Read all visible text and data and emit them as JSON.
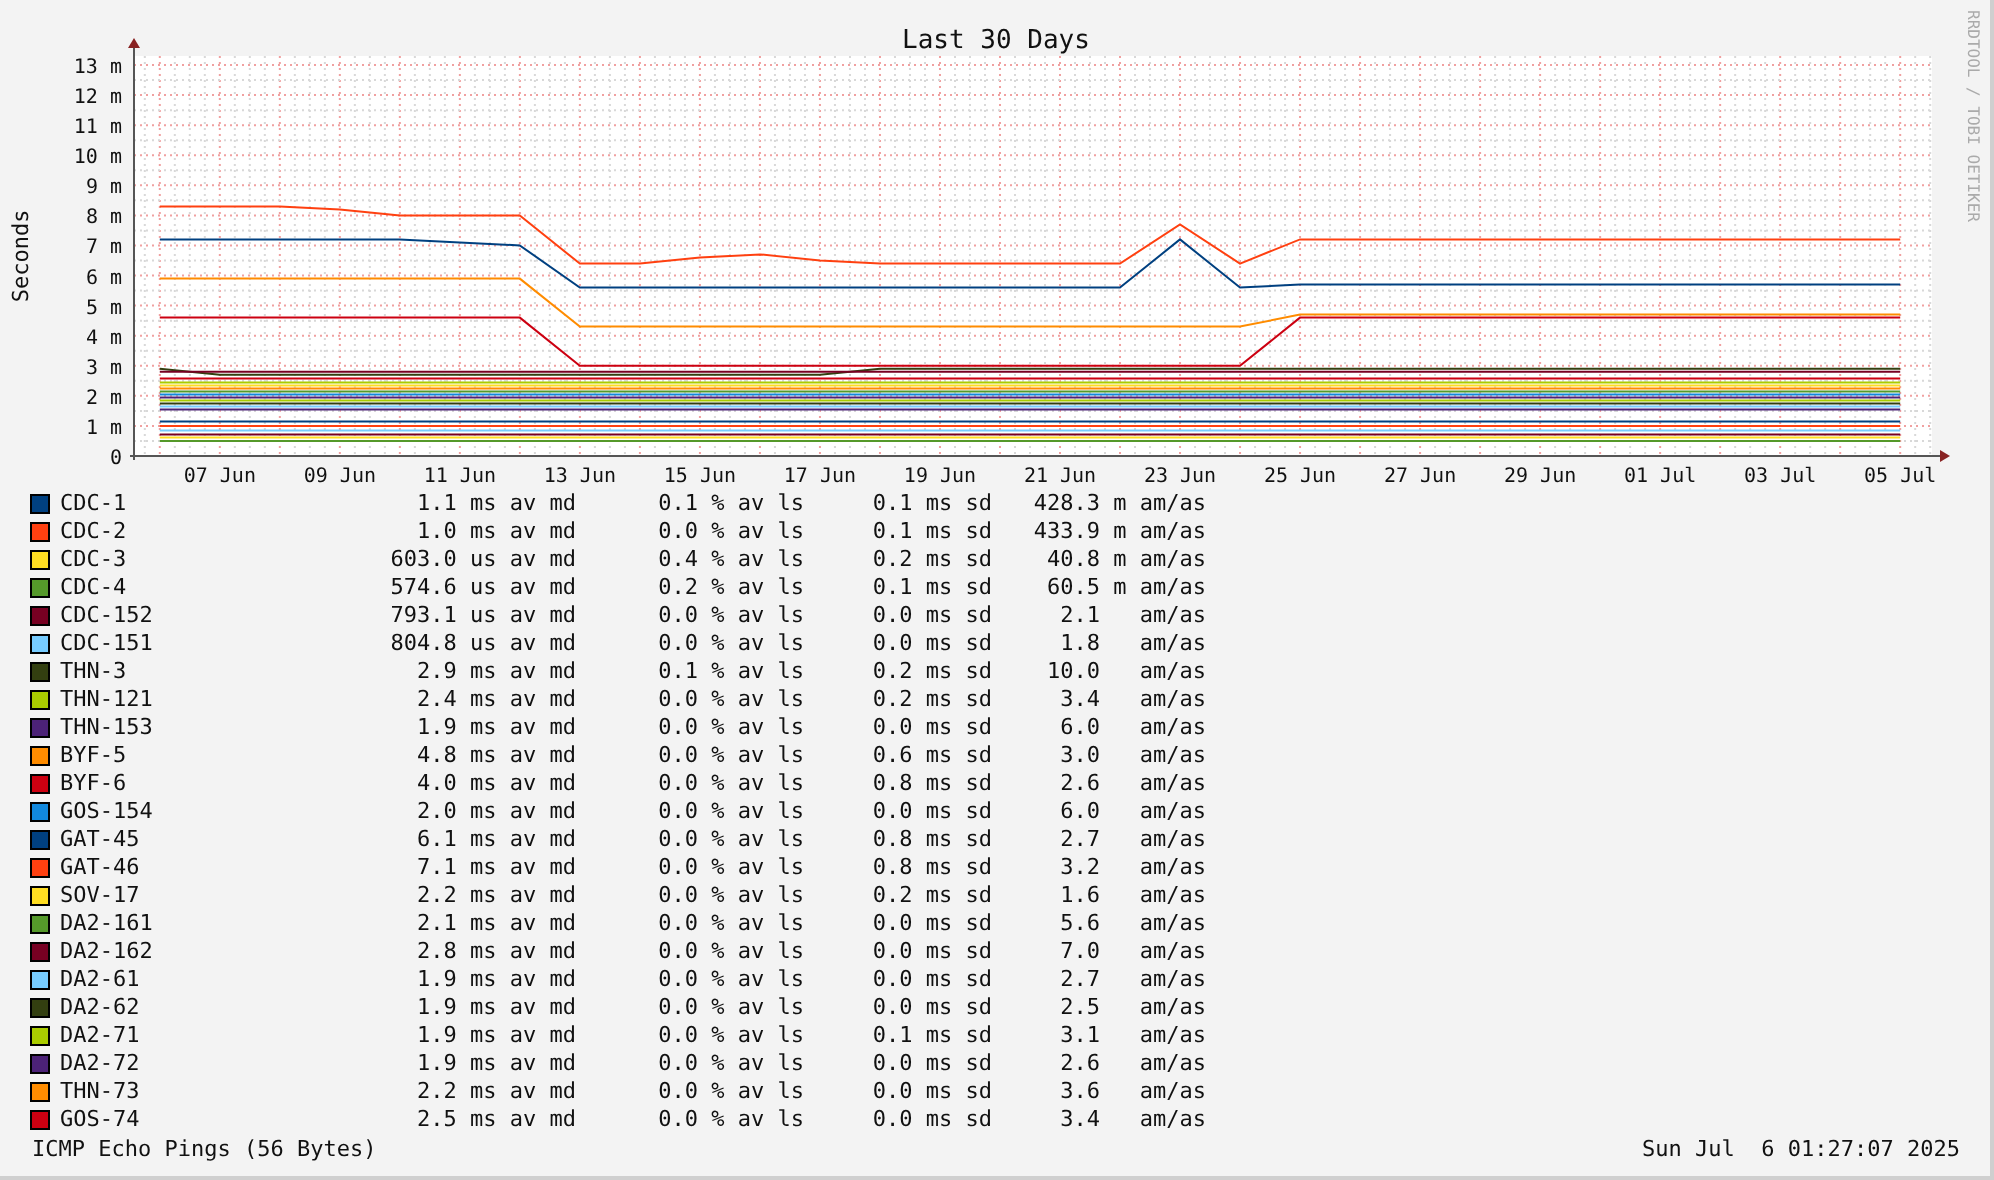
{
  "credit": "RRDTOOL / TOBI OETIKER",
  "chart_data": {
    "type": "line",
    "title": "Last 30 Days",
    "ylabel": "Seconds",
    "categories": [
      null,
      "07 Jun",
      null,
      "09 Jun",
      null,
      "11 Jun",
      null,
      "13 Jun",
      null,
      "15 Jun",
      null,
      "17 Jun",
      null,
      "19 Jun",
      null,
      "21 Jun",
      null,
      "23 Jun",
      null,
      "25 Jun",
      null,
      "27 Jun",
      null,
      "29 Jun",
      null,
      "01 Jul",
      null,
      "03 Jul",
      null,
      "05 Jul"
    ],
    "ylim": [
      0,
      13.3
    ],
    "grid": true,
    "yticks": [
      {
        "value": 0,
        "label": "0"
      },
      {
        "value": 1,
        "label": "1 m"
      },
      {
        "value": 2,
        "label": "2 m"
      },
      {
        "value": 3,
        "label": "3 m"
      },
      {
        "value": 4,
        "label": "4 m"
      },
      {
        "value": 5,
        "label": "5 m"
      },
      {
        "value": 6,
        "label": "6 m"
      },
      {
        "value": 7,
        "label": "7 m"
      },
      {
        "value": 8,
        "label": "8 m"
      },
      {
        "value": 9,
        "label": "9 m"
      },
      {
        "value": 10,
        "label": "10 m"
      },
      {
        "value": 11,
        "label": "11 m"
      },
      {
        "value": 12,
        "label": "12 m"
      },
      {
        "value": 13,
        "label": "13 m"
      }
    ],
    "series": [
      {
        "name": "CDC-1",
        "color": "#004080",
        "values": [
          1.15,
          1.15,
          1.15,
          1.15,
          1.15,
          1.15,
          1.15,
          1.15,
          1.15,
          1.15,
          1.15,
          1.15,
          1.15,
          1.15,
          1.15,
          1.15,
          1.15,
          1.15,
          1.15,
          1.15,
          1.15,
          1.15,
          1.15,
          1.15,
          1.15,
          1.15,
          1.15,
          1.15,
          1.15,
          1.15
        ]
      },
      {
        "name": "CDC-2",
        "color": "#ff4010",
        "values": [
          1.0,
          1.0,
          1.0,
          1.0,
          1.0,
          1.0,
          1.0,
          1.0,
          1.0,
          1.0,
          1.0,
          1.0,
          1.0,
          1.0,
          1.0,
          1.0,
          1.0,
          1.0,
          1.0,
          1.0,
          1.0,
          1.0,
          1.0,
          1.0,
          1.0,
          1.0,
          1.0,
          1.0,
          1.0,
          1.0
        ]
      },
      {
        "name": "CDC-3",
        "color": "#ffdd22",
        "values": [
          0.62,
          0.62,
          0.62,
          0.62,
          0.62,
          0.62,
          0.62,
          0.62,
          0.62,
          0.62,
          0.62,
          0.62,
          0.62,
          0.62,
          0.62,
          0.62,
          0.62,
          0.62,
          0.62,
          0.62,
          0.62,
          0.62,
          0.62,
          0.62,
          0.62,
          0.62,
          0.62,
          0.62,
          0.62,
          0.62
        ]
      },
      {
        "name": "CDC-4",
        "color": "#55992a",
        "values": [
          0.5,
          0.5,
          0.5,
          0.5,
          0.5,
          0.5,
          0.5,
          0.5,
          0.5,
          0.5,
          0.5,
          0.5,
          0.5,
          0.5,
          0.5,
          0.5,
          0.5,
          0.5,
          0.5,
          0.5,
          0.5,
          0.5,
          0.5,
          0.5,
          0.5,
          0.5,
          0.5,
          0.5,
          0.5,
          0.5
        ]
      },
      {
        "name": "CDC-152",
        "color": "#770022",
        "values": [
          0.72,
          0.72,
          0.72,
          0.72,
          0.72,
          0.72,
          0.72,
          0.72,
          0.72,
          0.72,
          0.72,
          0.72,
          0.72,
          0.72,
          0.72,
          0.72,
          0.72,
          0.72,
          0.72,
          0.72,
          0.72,
          0.72,
          0.72,
          0.72,
          0.72,
          0.72,
          0.72,
          0.72,
          0.72,
          0.72
        ]
      },
      {
        "name": "CDC-151",
        "color": "#77ccff",
        "values": [
          0.85,
          0.85,
          0.85,
          0.85,
          0.85,
          0.85,
          0.85,
          0.85,
          0.85,
          0.85,
          0.85,
          0.85,
          0.85,
          0.85,
          0.85,
          0.85,
          0.85,
          0.85,
          0.85,
          0.85,
          0.85,
          0.85,
          0.85,
          0.85,
          0.85,
          0.85,
          0.85,
          0.85,
          0.85,
          0.85
        ]
      },
      {
        "name": "THN-3",
        "color": "#333f10",
        "values": [
          2.9,
          2.7,
          2.7,
          2.7,
          2.7,
          2.7,
          2.7,
          2.7,
          2.7,
          2.7,
          2.7,
          2.7,
          2.9,
          2.9,
          2.9,
          2.9,
          2.9,
          2.9,
          2.9,
          2.9,
          2.9,
          2.9,
          2.9,
          2.9,
          2.9,
          2.9,
          2.9,
          2.9,
          2.9,
          2.9
        ]
      },
      {
        "name": "THN-121",
        "color": "#aacc00",
        "values": [
          2.45,
          2.45,
          2.45,
          2.45,
          2.45,
          2.45,
          2.45,
          2.45,
          2.45,
          2.45,
          2.45,
          2.45,
          2.45,
          2.45,
          2.45,
          2.45,
          2.45,
          2.45,
          2.45,
          2.45,
          2.45,
          2.45,
          2.45,
          2.45,
          2.45,
          2.45,
          2.45,
          2.45,
          2.45,
          2.45
        ]
      },
      {
        "name": "THN-153",
        "color": "#4c2277",
        "values": [
          1.95,
          1.95,
          1.95,
          1.95,
          1.95,
          1.95,
          1.95,
          1.95,
          1.95,
          1.95,
          1.95,
          1.95,
          1.95,
          1.95,
          1.95,
          1.95,
          1.95,
          1.95,
          1.95,
          1.95,
          1.95,
          1.95,
          1.95,
          1.95,
          1.95,
          1.95,
          1.95,
          1.95,
          1.95,
          1.95
        ]
      },
      {
        "name": "BYF-5",
        "color": "#ff8c00",
        "values": [
          5.9,
          5.9,
          5.9,
          5.9,
          5.9,
          5.9,
          5.9,
          4.3,
          4.3,
          4.3,
          4.3,
          4.3,
          4.3,
          4.3,
          4.3,
          4.3,
          4.3,
          4.3,
          4.3,
          4.7,
          4.7,
          4.7,
          4.7,
          4.7,
          4.7,
          4.7,
          4.7,
          4.7,
          4.7,
          4.7
        ]
      },
      {
        "name": "BYF-6",
        "color": "#cc0011",
        "values": [
          4.6,
          4.6,
          4.6,
          4.6,
          4.6,
          4.6,
          4.6,
          3.0,
          3.0,
          3.0,
          3.0,
          3.0,
          3.0,
          3.0,
          3.0,
          3.0,
          3.0,
          3.0,
          3.0,
          4.6,
          4.6,
          4.6,
          4.6,
          4.6,
          4.6,
          4.6,
          4.6,
          4.6,
          4.6,
          4.6
        ]
      },
      {
        "name": "GOS-154",
        "color": "#1188dd",
        "values": [
          2.05,
          2.05,
          2.05,
          2.05,
          2.05,
          2.05,
          2.05,
          2.05,
          2.05,
          2.05,
          2.05,
          2.05,
          2.05,
          2.05,
          2.05,
          2.05,
          2.05,
          2.05,
          2.05,
          2.05,
          2.05,
          2.05,
          2.05,
          2.05,
          2.05,
          2.05,
          2.05,
          2.05,
          2.05,
          2.05
        ]
      },
      {
        "name": "GAT-45",
        "color": "#004080",
        "values": [
          7.2,
          7.2,
          7.2,
          7.2,
          7.2,
          7.1,
          7.0,
          5.6,
          5.6,
          5.6,
          5.6,
          5.6,
          5.6,
          5.6,
          5.6,
          5.6,
          5.6,
          7.2,
          5.6,
          5.7,
          5.7,
          5.7,
          5.7,
          5.7,
          5.7,
          5.7,
          5.7,
          5.7,
          5.7,
          5.7
        ]
      },
      {
        "name": "GAT-46",
        "color": "#ff4010",
        "values": [
          8.3,
          8.3,
          8.3,
          8.2,
          8.0,
          8.0,
          8.0,
          6.4,
          6.4,
          6.6,
          6.7,
          6.5,
          6.4,
          6.4,
          6.4,
          6.4,
          6.4,
          7.7,
          6.4,
          7.2,
          7.2,
          7.2,
          7.2,
          7.2,
          7.2,
          7.2,
          7.2,
          7.2,
          7.2,
          7.2
        ]
      },
      {
        "name": "SOV-17",
        "color": "#ffdd22",
        "values": [
          2.35,
          2.35,
          2.35,
          2.35,
          2.35,
          2.35,
          2.35,
          2.35,
          2.35,
          2.35,
          2.35,
          2.35,
          2.35,
          2.35,
          2.35,
          2.35,
          2.35,
          2.35,
          2.35,
          2.35,
          2.35,
          2.35,
          2.35,
          2.35,
          2.35,
          2.35,
          2.35,
          2.35,
          2.35,
          2.35
        ]
      },
      {
        "name": "DA2-161",
        "color": "#55992a",
        "values": [
          2.15,
          2.15,
          2.15,
          2.15,
          2.15,
          2.15,
          2.15,
          2.15,
          2.15,
          2.15,
          2.15,
          2.15,
          2.15,
          2.15,
          2.15,
          2.15,
          2.15,
          2.15,
          2.15,
          2.15,
          2.15,
          2.15,
          2.15,
          2.15,
          2.15,
          2.15,
          2.15,
          2.15,
          2.15,
          2.15
        ]
      },
      {
        "name": "DA2-162",
        "color": "#770022",
        "values": [
          2.8,
          2.8,
          2.8,
          2.8,
          2.8,
          2.8,
          2.8,
          2.8,
          2.8,
          2.8,
          2.8,
          2.8,
          2.8,
          2.8,
          2.8,
          2.8,
          2.8,
          2.8,
          2.8,
          2.8,
          2.8,
          2.8,
          2.8,
          2.8,
          2.8,
          2.8,
          2.8,
          2.8,
          2.8,
          2.8
        ]
      },
      {
        "name": "DA2-61",
        "color": "#77ccff",
        "values": [
          1.65,
          1.65,
          1.65,
          1.65,
          1.65,
          1.65,
          1.65,
          1.65,
          1.65,
          1.65,
          1.65,
          1.65,
          1.65,
          1.65,
          1.65,
          1.65,
          1.65,
          1.65,
          1.65,
          1.65,
          1.65,
          1.65,
          1.65,
          1.65,
          1.65,
          1.65,
          1.65,
          1.65,
          1.65,
          1.65
        ]
      },
      {
        "name": "DA2-62",
        "color": "#333f10",
        "values": [
          1.75,
          1.75,
          1.75,
          1.75,
          1.75,
          1.75,
          1.75,
          1.75,
          1.75,
          1.75,
          1.75,
          1.75,
          1.75,
          1.75,
          1.75,
          1.75,
          1.75,
          1.75,
          1.75,
          1.75,
          1.75,
          1.75,
          1.75,
          1.75,
          1.75,
          1.75,
          1.75,
          1.75,
          1.75,
          1.75
        ]
      },
      {
        "name": "DA2-71",
        "color": "#aacc00",
        "values": [
          1.85,
          1.85,
          1.85,
          1.85,
          1.85,
          1.85,
          1.85,
          1.85,
          1.85,
          1.85,
          1.85,
          1.85,
          1.85,
          1.85,
          1.85,
          1.85,
          1.85,
          1.85,
          1.85,
          1.85,
          1.85,
          1.85,
          1.85,
          1.85,
          1.85,
          1.85,
          1.85,
          1.85,
          1.85,
          1.85
        ]
      },
      {
        "name": "DA2-72",
        "color": "#4c2277",
        "values": [
          1.55,
          1.55,
          1.55,
          1.55,
          1.55,
          1.55,
          1.55,
          1.55,
          1.55,
          1.55,
          1.55,
          1.55,
          1.55,
          1.55,
          1.55,
          1.55,
          1.55,
          1.55,
          1.55,
          1.55,
          1.55,
          1.55,
          1.55,
          1.55,
          1.55,
          1.55,
          1.55,
          1.55,
          1.55,
          1.55
        ]
      },
      {
        "name": "THN-73",
        "color": "#ff8c00",
        "values": [
          2.25,
          2.25,
          2.25,
          2.25,
          2.25,
          2.25,
          2.25,
          2.25,
          2.25,
          2.25,
          2.25,
          2.25,
          2.25,
          2.25,
          2.25,
          2.25,
          2.25,
          2.25,
          2.25,
          2.25,
          2.25,
          2.25,
          2.25,
          2.25,
          2.25,
          2.25,
          2.25,
          2.25,
          2.25,
          2.25
        ]
      },
      {
        "name": "GOS-74",
        "color": "#cc0011",
        "values": [
          2.58,
          2.58,
          2.58,
          2.58,
          2.58,
          2.58,
          2.58,
          2.58,
          2.58,
          2.58,
          2.58,
          2.58,
          2.58,
          2.58,
          2.58,
          2.58,
          2.58,
          2.58,
          2.58,
          2.58,
          2.58,
          2.58,
          2.58,
          2.58,
          2.58,
          2.58,
          2.58,
          2.58,
          2.58,
          2.58
        ]
      }
    ]
  },
  "legend": [
    {
      "median": "1.1 ms av md",
      "loss": "0.1 % av ls",
      "sd": "0.1 ms sd",
      "am": "428.3 m am/as"
    },
    {
      "median": "1.0 ms av md",
      "loss": "0.0 % av ls",
      "sd": "0.1 ms sd",
      "am": "433.9 m am/as"
    },
    {
      "median": "603.0 us av md",
      "loss": "0.4 % av ls",
      "sd": "0.2 ms sd",
      "am": "40.8 m am/as"
    },
    {
      "median": "574.6 us av md",
      "loss": "0.2 % av ls",
      "sd": "0.1 ms sd",
      "am": "60.5 m am/as"
    },
    {
      "median": "793.1 us av md",
      "loss": "0.0 % av ls",
      "sd": "0.0 ms sd",
      "am": "2.1   am/as"
    },
    {
      "median": "804.8 us av md",
      "loss": "0.0 % av ls",
      "sd": "0.0 ms sd",
      "am": "1.8   am/as"
    },
    {
      "median": "2.9 ms av md",
      "loss": "0.1 % av ls",
      "sd": "0.2 ms sd",
      "am": "10.0   am/as"
    },
    {
      "median": "2.4 ms av md",
      "loss": "0.0 % av ls",
      "sd": "0.2 ms sd",
      "am": "3.4   am/as"
    },
    {
      "median": "1.9 ms av md",
      "loss": "0.0 % av ls",
      "sd": "0.0 ms sd",
      "am": "6.0   am/as"
    },
    {
      "median": "4.8 ms av md",
      "loss": "0.0 % av ls",
      "sd": "0.6 ms sd",
      "am": "3.0   am/as"
    },
    {
      "median": "4.0 ms av md",
      "loss": "0.0 % av ls",
      "sd": "0.8 ms sd",
      "am": "2.6   am/as"
    },
    {
      "median": "2.0 ms av md",
      "loss": "0.0 % av ls",
      "sd": "0.0 ms sd",
      "am": "6.0   am/as"
    },
    {
      "median": "6.1 ms av md",
      "loss": "0.0 % av ls",
      "sd": "0.8 ms sd",
      "am": "2.7   am/as"
    },
    {
      "median": "7.1 ms av md",
      "loss": "0.0 % av ls",
      "sd": "0.8 ms sd",
      "am": "3.2   am/as"
    },
    {
      "median": "2.2 ms av md",
      "loss": "0.0 % av ls",
      "sd": "0.2 ms sd",
      "am": "1.6   am/as"
    },
    {
      "median": "2.1 ms av md",
      "loss": "0.0 % av ls",
      "sd": "0.0 ms sd",
      "am": "5.6   am/as"
    },
    {
      "median": "2.8 ms av md",
      "loss": "0.0 % av ls",
      "sd": "0.0 ms sd",
      "am": "7.0   am/as"
    },
    {
      "median": "1.9 ms av md",
      "loss": "0.0 % av ls",
      "sd": "0.0 ms sd",
      "am": "2.7   am/as"
    },
    {
      "median": "1.9 ms av md",
      "loss": "0.0 % av ls",
      "sd": "0.0 ms sd",
      "am": "2.5   am/as"
    },
    {
      "median": "1.9 ms av md",
      "loss": "0.0 % av ls",
      "sd": "0.1 ms sd",
      "am": "3.1   am/as"
    },
    {
      "median": "1.9 ms av md",
      "loss": "0.0 % av ls",
      "sd": "0.0 ms sd",
      "am": "2.6   am/as"
    },
    {
      "median": "2.2 ms av md",
      "loss": "0.0 % av ls",
      "sd": "0.0 ms sd",
      "am": "3.6   am/as"
    },
    {
      "median": "2.5 ms av md",
      "loss": "0.0 % av ls",
      "sd": "0.0 ms sd",
      "am": "3.4   am/as"
    }
  ],
  "footer": {
    "probe": "ICMP Echo Pings (56 Bytes)",
    "timestamp": "Sun Jul  6 01:27:07 2025"
  }
}
